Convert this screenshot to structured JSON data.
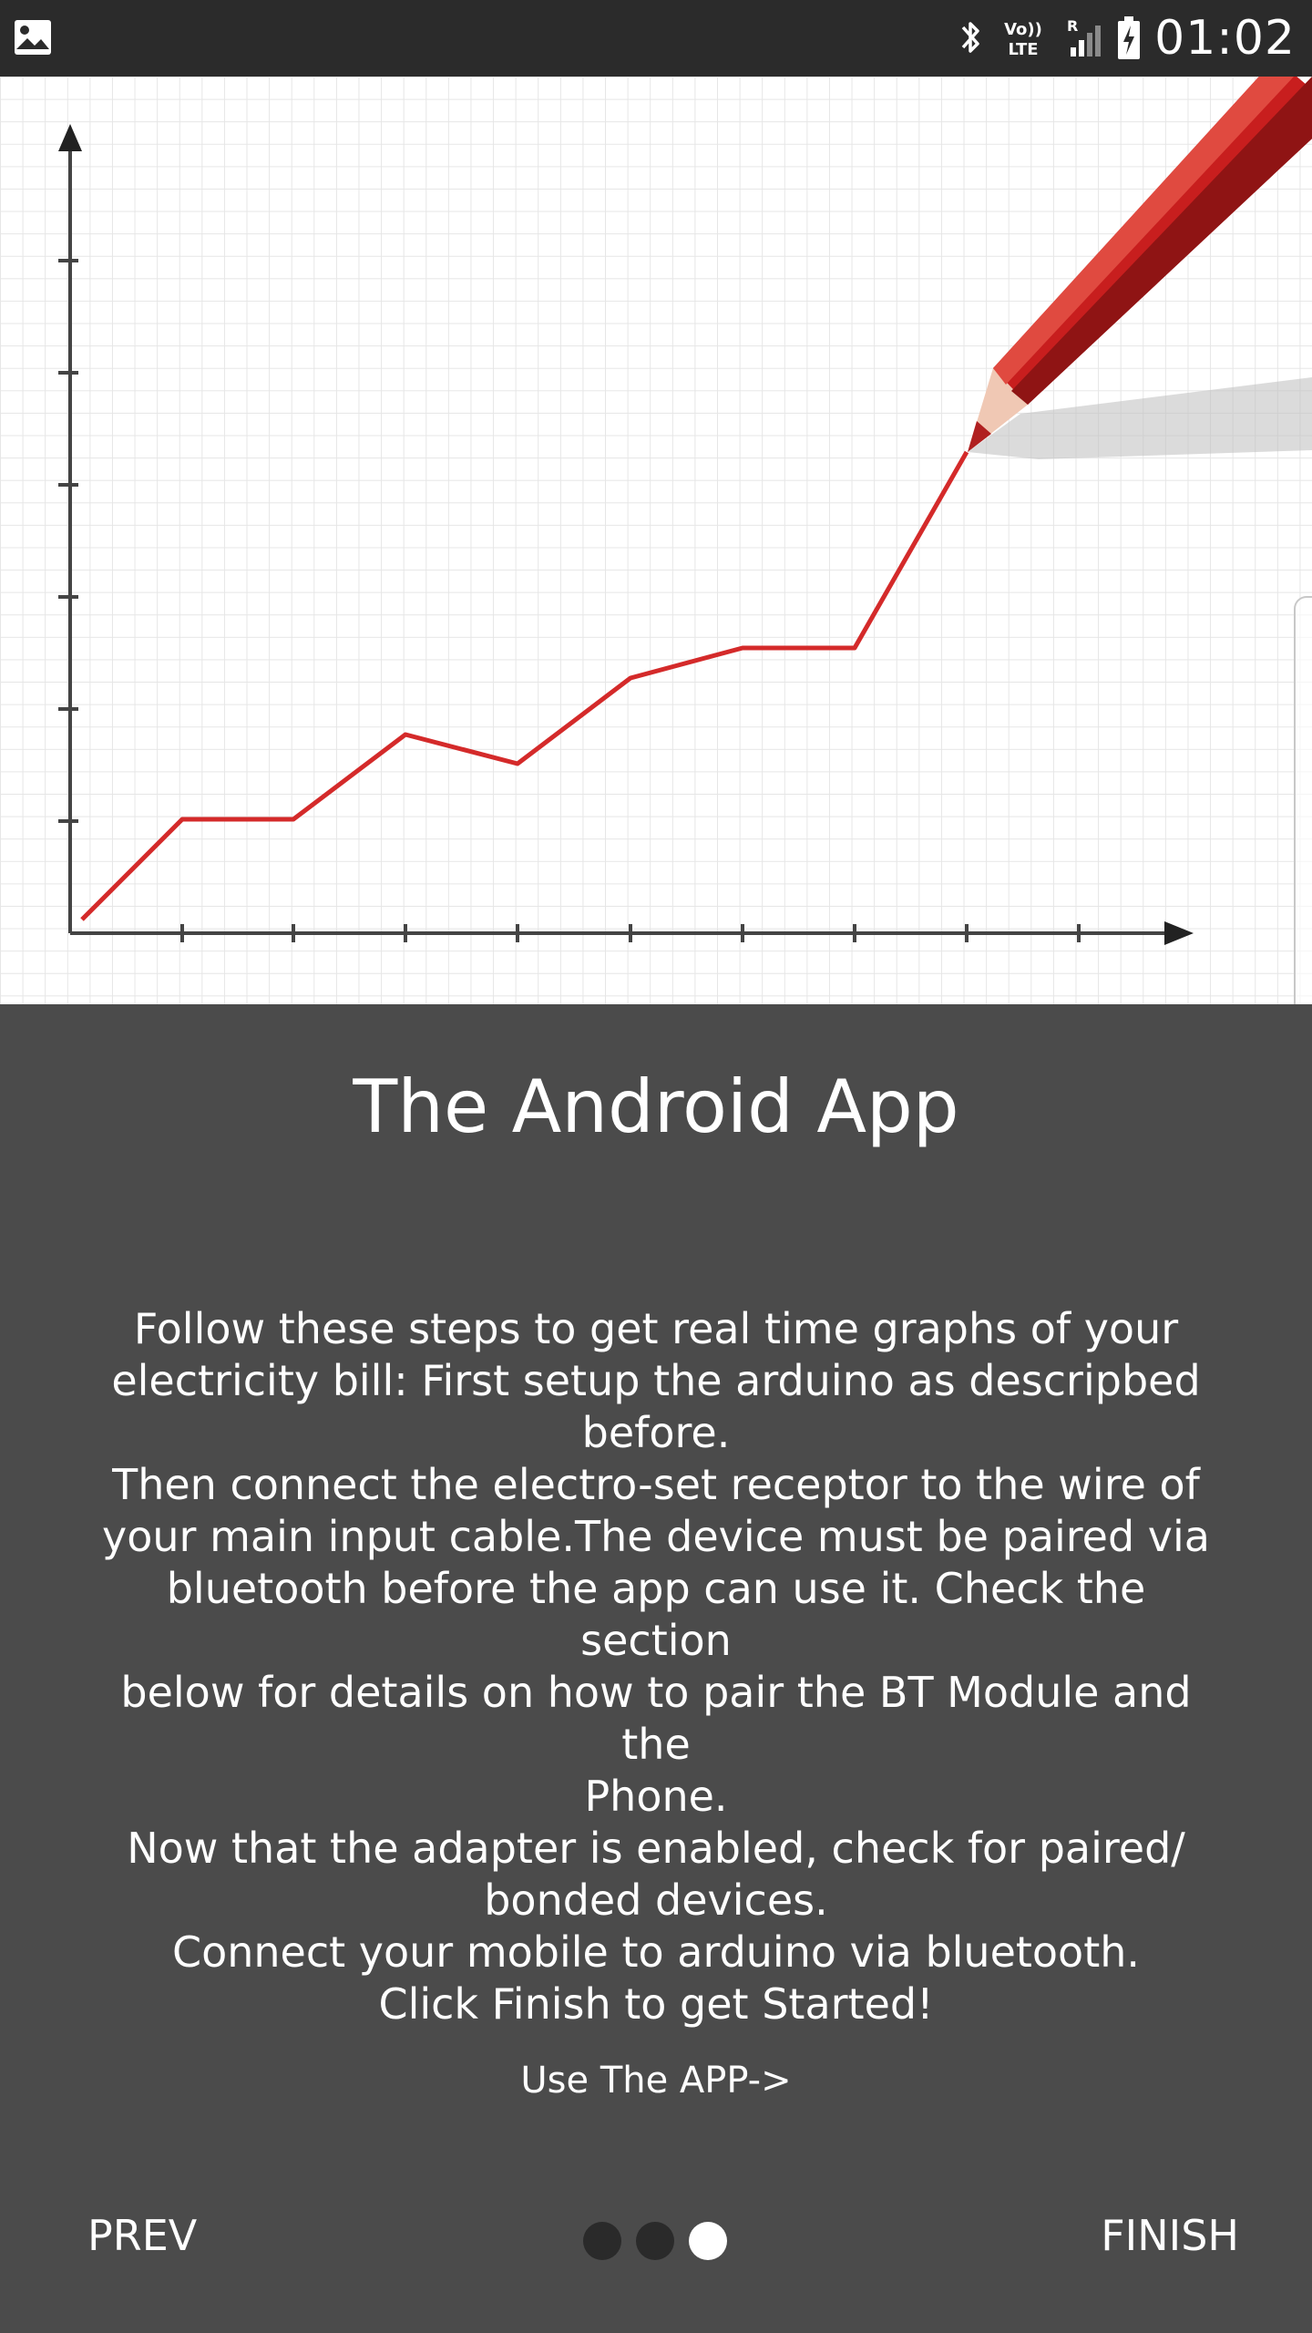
{
  "status_bar": {
    "time": "01:02",
    "icons": [
      "image-icon",
      "bluetooth-icon",
      "volte-icon",
      "signal-roaming-icon",
      "battery-charging-icon"
    ],
    "volte_text_top": "Vo))",
    "volte_text_bottom": "LTE",
    "roaming_text": "R"
  },
  "hero": {
    "illustration": "line-graph-with-red-pencil",
    "line_color": "#d42a2a",
    "pencil_color": "#c81e1e"
  },
  "page": {
    "title": "The Android App",
    "description_lines": [
      "Follow these steps to get real time graphs of your",
      "electricity bill: First setup the arduino as descripbed",
      "before.",
      "Then connect the electro-set receptor to the wire of",
      "your main input cable.The device must be paired via",
      "bluetooth before the app can use it. Check the section",
      "below for details on how to pair the BT Module and the",
      "Phone.",
      "Now that the adapter is enabled, check for paired/",
      "bonded devices.",
      "Connect your mobile to arduino via bluetooth.",
      "Click Finish to get Started!"
    ],
    "use_app_link": "Use The APP->"
  },
  "navigation": {
    "prev_label": "PREV",
    "finish_label": "FINISH",
    "page_count": 3,
    "active_page": 3
  },
  "colors": {
    "status_bar_bg": "#2b2b2b",
    "content_bg": "#4b4b4b",
    "dot_inactive": "#2a2a2a",
    "dot_active": "#ffffff"
  }
}
